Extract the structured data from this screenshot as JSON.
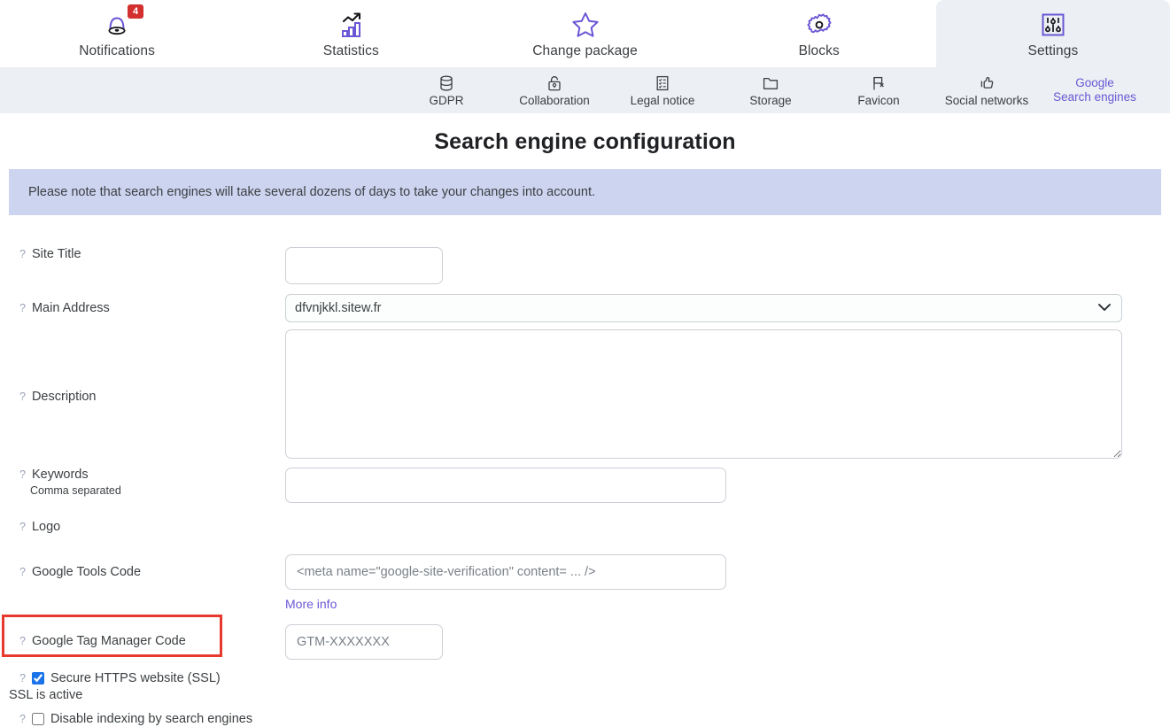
{
  "topnav": {
    "items": [
      {
        "label": "Notifications",
        "icon": "bell-icon",
        "badge": "4",
        "active": false
      },
      {
        "label": "Statistics",
        "icon": "bar-chart-icon",
        "active": false
      },
      {
        "label": "Change package",
        "icon": "star-icon",
        "active": false
      },
      {
        "label": "Blocks",
        "icon": "gear-icon",
        "active": false
      },
      {
        "label": "Settings",
        "icon": "sliders-icon",
        "active": true
      }
    ]
  },
  "subnav": {
    "items": [
      {
        "label": "GDPR",
        "icon": "database-icon",
        "active": false
      },
      {
        "label": "Collaboration",
        "icon": "unlock-icon",
        "active": false
      },
      {
        "label": "Legal notice",
        "icon": "document-list-icon",
        "active": false
      },
      {
        "label": "Storage",
        "icon": "folder-icon",
        "active": false
      },
      {
        "label": "Favicon",
        "icon": "flag-icon",
        "active": false
      },
      {
        "label": "Social networks",
        "icon": "thumbs-up-icon",
        "active": false
      },
      {
        "label": "Search engines",
        "icon": "google-text",
        "top_text": "Google",
        "active": true
      }
    ]
  },
  "page": {
    "title": "Search engine configuration",
    "notice": "Please note that search engines will take several dozens of days to take your changes into account."
  },
  "form": {
    "help_marker": "?",
    "site_title": {
      "label": "Site Title",
      "value": "",
      "placeholder": ""
    },
    "main_address": {
      "label": "Main Address",
      "selected": "dfvnjkkl.sitew.fr",
      "options": [
        "dfvnjkkl.sitew.fr"
      ]
    },
    "description": {
      "label": "Description",
      "value": "",
      "placeholder": ""
    },
    "keywords": {
      "label": "Keywords",
      "hint": "Comma separated",
      "value": "",
      "placeholder": ""
    },
    "logo": {
      "label": "Logo"
    },
    "google_tools_code": {
      "label": "Google Tools Code",
      "value": "",
      "placeholder": "<meta name=\"google-site-verification\" content= ... />",
      "more_info": "More info"
    },
    "gtm_code": {
      "label": "Google Tag Manager Code",
      "value": "",
      "placeholder": "GTM-XXXXXXX"
    },
    "ssl": {
      "label": "Secure HTTPS website (SSL)",
      "checked": true,
      "status": "SSL is active"
    },
    "disable_indexing": {
      "label": "Disable indexing by search engines",
      "checked": false
    }
  },
  "colors": {
    "accent_purple": "#6a57d5",
    "highlight_red": "#e8392e",
    "notice_bg": "#ccd4f0",
    "subnav_bg": "#eceff3",
    "badge_red": "#d32f2f",
    "checkbox_blue": "#1a73e8"
  }
}
